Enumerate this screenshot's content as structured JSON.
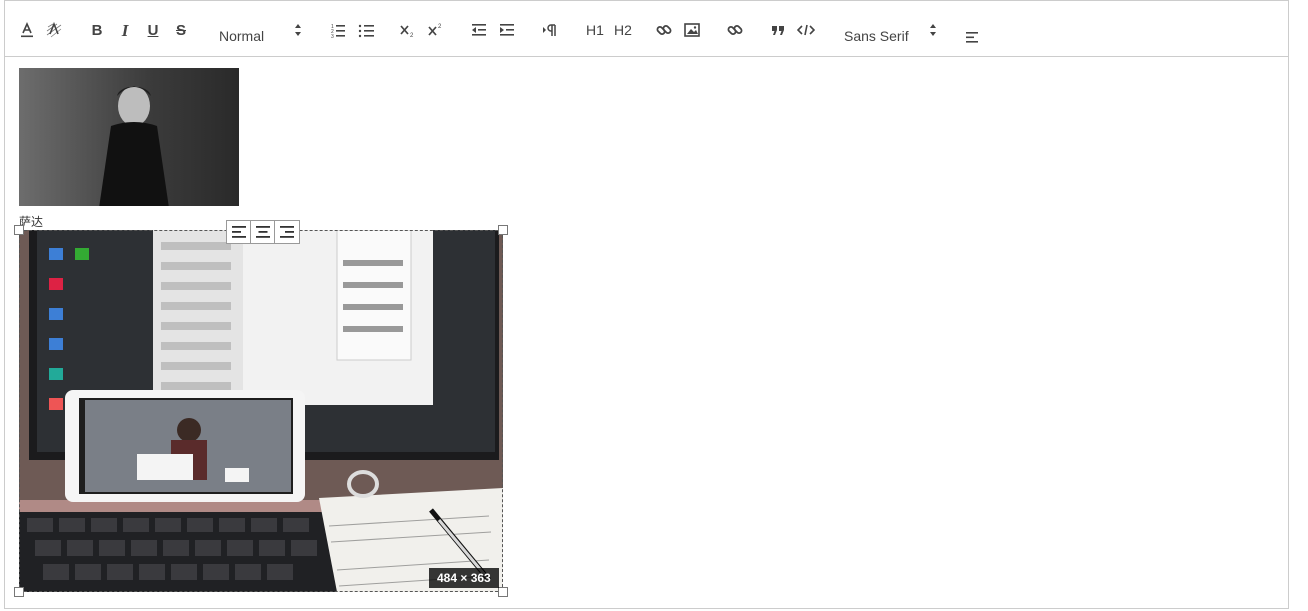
{
  "toolbar": {
    "buttons": [
      {
        "name": "text-color-icon"
      },
      {
        "name": "background-color-icon"
      },
      {
        "name": "bold-icon",
        "glyph": "B"
      },
      {
        "name": "italic-icon",
        "glyph": "I"
      },
      {
        "name": "underline-icon",
        "glyph": "U"
      },
      {
        "name": "strikethrough-icon",
        "glyph": "S"
      }
    ],
    "header_picker": {
      "value": "Normal"
    },
    "font_picker": {
      "value": "Sans Serif"
    },
    "header1_label": "H1",
    "header2_label": "H2"
  },
  "content": {
    "caption": "萨达",
    "image_size": "484 × 363"
  },
  "colors": {
    "border": "#cccccc",
    "icon": "#444444",
    "badge_bg": "#1a1a1a"
  }
}
